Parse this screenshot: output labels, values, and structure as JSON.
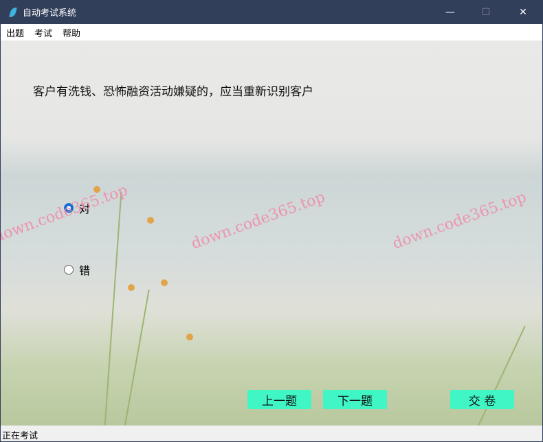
{
  "window": {
    "title": "自动考试系统",
    "minimize": "—",
    "maximize": "☐",
    "close": "✕"
  },
  "menu": [
    "出题",
    "考试",
    "帮助"
  ],
  "question": {
    "text": "客户有洗钱、恐怖融资活动嫌疑的，应当重新识别客户",
    "options": [
      {
        "label": "对",
        "selected": true
      },
      {
        "label": "错",
        "selected": false
      }
    ]
  },
  "watermark": "down.code365.top",
  "buttons": {
    "prev": "上一题",
    "next": "下一题",
    "submit": "交 卷"
  },
  "status": "正在考试",
  "colors": {
    "button": "#3ff6c4",
    "titlebar": "#323f5a"
  }
}
